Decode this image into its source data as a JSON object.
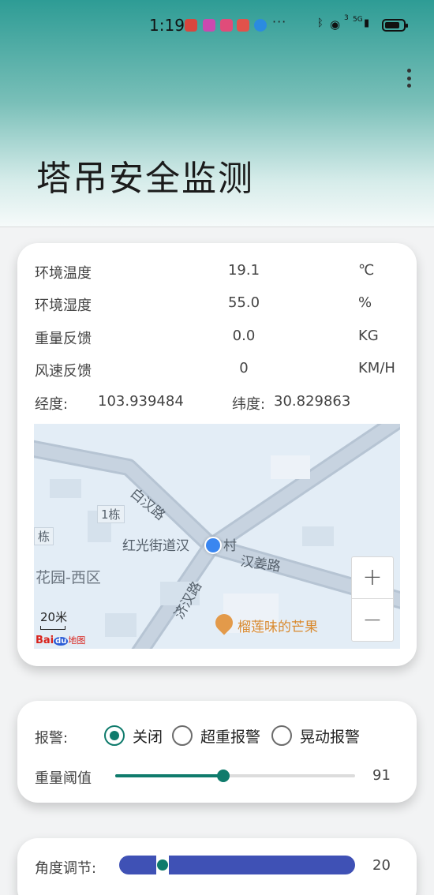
{
  "status_bar": {
    "time": "1:19",
    "more": "···",
    "network": "5G",
    "sim": "3"
  },
  "header": {
    "title": "塔吊安全监测",
    "menu_icon": "more-vert-icon",
    "gradient_top": "#2e9c95",
    "gradient_bottom": "#f6fafa"
  },
  "sensors": [
    {
      "label": "环境温度",
      "value": "19.1",
      "unit": "℃"
    },
    {
      "label": "环境湿度",
      "value": "55.0",
      "unit": "%"
    },
    {
      "label": "重量反馈",
      "value": "0.0",
      "unit": "KG"
    },
    {
      "label": "风速反馈",
      "value": "0",
      "unit": "KM/H"
    }
  ],
  "location": {
    "lng_label": "经度:",
    "lng_value": "103.939484",
    "lat_label": "纬度:",
    "lat_value": "30.829863"
  },
  "map": {
    "labels": {
      "bai_han_lu": "白汉路",
      "building_1": "1栋",
      "building_edge": "栋",
      "street": "红光街道汉",
      "street_tail": "村",
      "han_jiang_lu": "汉姜路",
      "garden": "花园-西区",
      "ji_han_lu": "济汉路",
      "poi": "榴莲味的芒果"
    },
    "scale": "20米",
    "logo_text": "Bai",
    "logo_du": "du",
    "logo_suffix": "地图",
    "zoom_in": "+",
    "zoom_out": "−",
    "background": "#e3edf6"
  },
  "alarm": {
    "label": "报警:",
    "options": [
      {
        "text": "关闭",
        "checked": true
      },
      {
        "text": "超重报警",
        "checked": false
      },
      {
        "text": "晃动报警",
        "checked": false
      }
    ]
  },
  "weight_threshold": {
    "label": "重量阈值",
    "value": "91",
    "fraction": 0.45
  },
  "angle": {
    "label": "角度调节:",
    "value": "20",
    "fraction": 0.1
  },
  "colors": {
    "accent": "#0f7b6c",
    "angle_track": "#3f51b5",
    "location_dot": "#3a86f0",
    "poi": "#d98a2f"
  }
}
